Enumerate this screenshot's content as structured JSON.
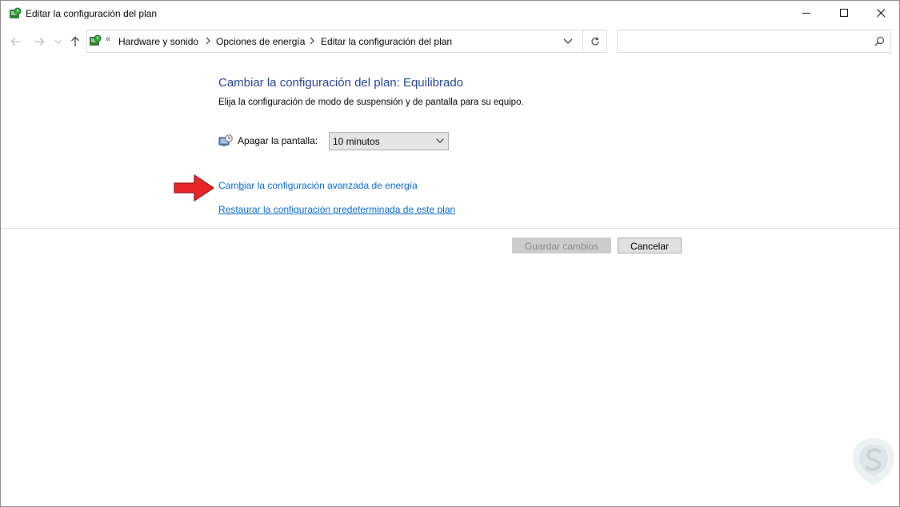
{
  "window": {
    "title": "Editar la configuración del plan",
    "icon": "power-options-icon"
  },
  "navigation": {
    "breadcrumb": [
      "Hardware y sonido",
      "Opciones de energía",
      "Editar la configuración del plan"
    ],
    "search_placeholder": ""
  },
  "main": {
    "heading": "Cambiar la configuración del plan: Equilibrado",
    "description": "Elija la configuración de modo de suspensión y de pantalla para su equipo.",
    "display_setting": {
      "label": "Apagar la pantalla:",
      "value": "10 minutos"
    },
    "links": {
      "advanced_pre": "Cam",
      "advanced_underlined": "b",
      "advanced_post": "iar la configuración avanzada de energía",
      "restore": "Restaurar la configuración predeterminada de este plan"
    }
  },
  "buttons": {
    "save": "Guardar cambios",
    "cancel": "Cancelar"
  },
  "colors": {
    "heading": "#1e3d8f",
    "link": "#0066cc",
    "arrow": "#e8262a",
    "disabled_button": "#cccccc"
  }
}
